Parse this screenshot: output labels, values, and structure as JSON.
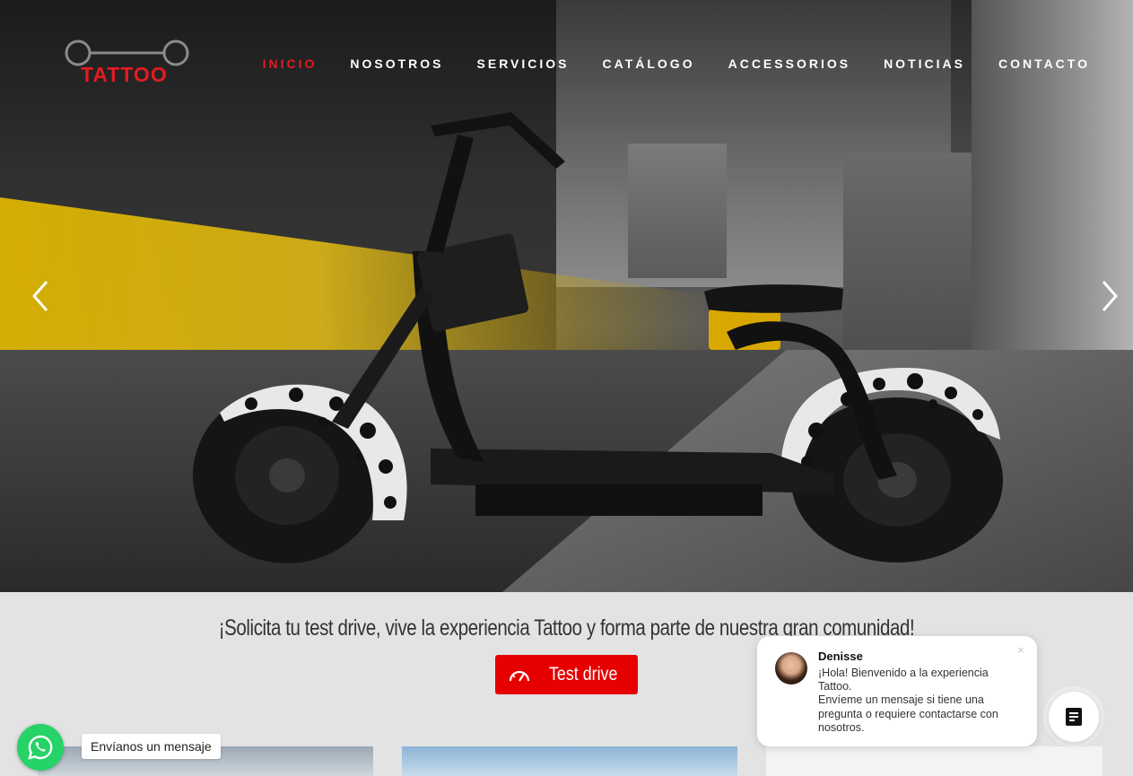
{
  "brand": {
    "name": "TATTOO",
    "color": "#e31b23"
  },
  "nav": {
    "items": [
      {
        "label": "INICIO",
        "active": true
      },
      {
        "label": "NOSOTROS",
        "active": false
      },
      {
        "label": "SERVICIOS",
        "active": false
      },
      {
        "label": "CATÁLOGO",
        "active": false
      },
      {
        "label": "ACCESSORIOS",
        "active": false
      },
      {
        "label": "NOTICIAS",
        "active": false
      },
      {
        "label": "CONTACTO",
        "active": false
      }
    ]
  },
  "slider": {
    "prev_icon": "chevron-left-icon",
    "next_icon": "chevron-right-icon"
  },
  "cta": {
    "tagline": "¡Solicita tu test drive, vive la experiencia Tattoo y forma parte de nuestra gran comunidad!",
    "button_label": "Test drive",
    "button_icon": "speedometer-icon",
    "button_color": "#e60000"
  },
  "whatsapp": {
    "label": "Envíanos un mensaje",
    "icon": "whatsapp-icon",
    "color": "#25d366"
  },
  "chat": {
    "agent_name": "Denisse",
    "message_line1": "¡Hola! Bienvenido a la experiencia Tattoo.",
    "message_line2": "Envíeme un mensaje si tiene una pregunta o requiere contactarse con nosotros.",
    "close_label": "×",
    "open_icon": "chat-icon"
  }
}
